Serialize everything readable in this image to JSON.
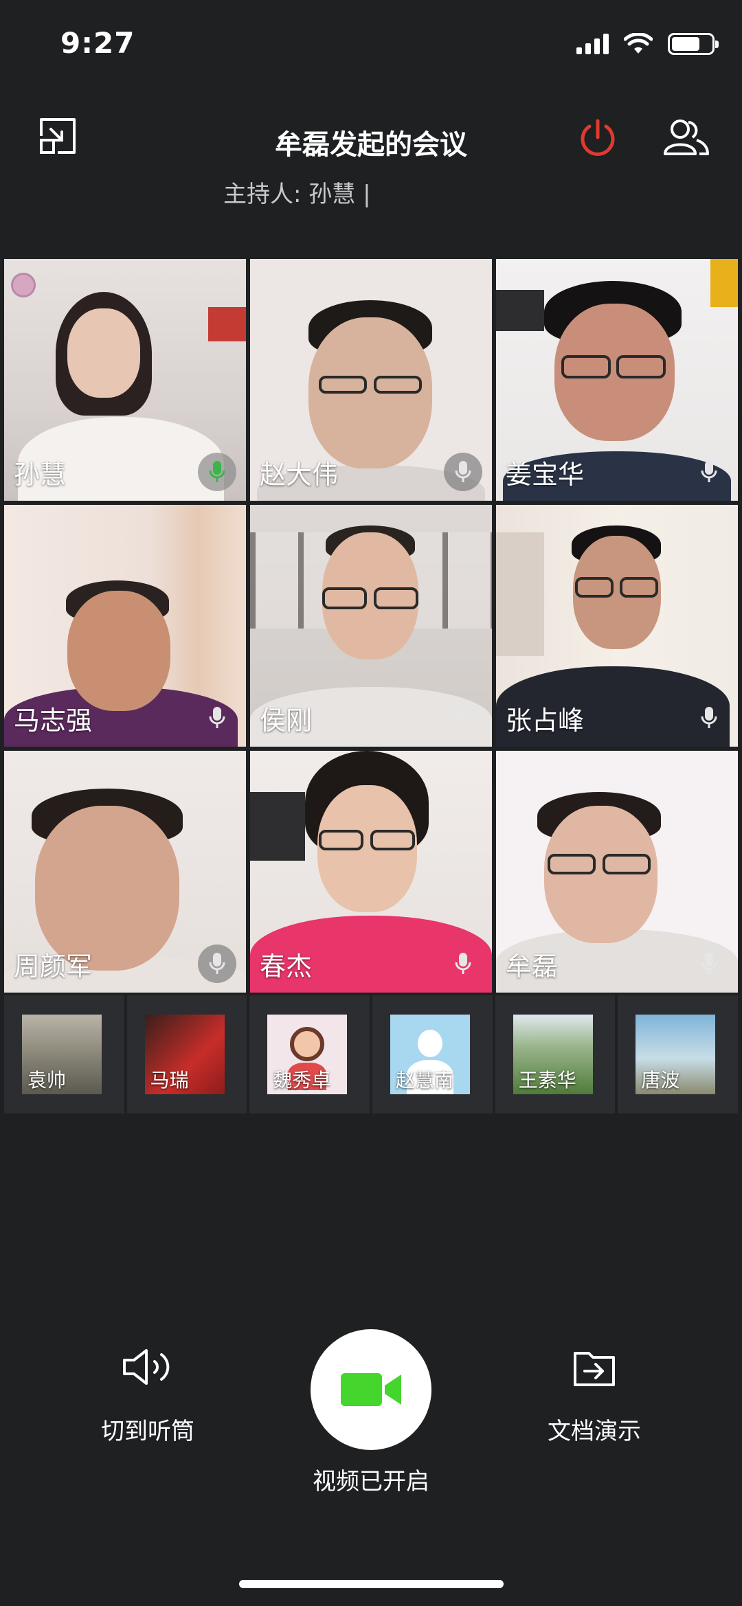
{
  "status_bar": {
    "time": "9:27"
  },
  "header": {
    "title": "牟磊发起的会议",
    "host_label": "主持人: 孙慧 |"
  },
  "grid": [
    {
      "name": "孙慧",
      "mic": "active"
    },
    {
      "name": "赵大伟",
      "mic": "idle"
    },
    {
      "name": "姜宝华",
      "mic": "idle"
    },
    {
      "name": "马志强",
      "mic": "idle"
    },
    {
      "name": "侯刚",
      "mic": "idle"
    },
    {
      "name": "张占峰",
      "mic": "idle"
    },
    {
      "name": "周颜军",
      "mic": "idle"
    },
    {
      "name": "春杰",
      "mic": "idle"
    },
    {
      "name": "牟磊",
      "mic": "idle"
    }
  ],
  "thumbnails": [
    {
      "name": "袁帅"
    },
    {
      "name": "马瑞"
    },
    {
      "name": "魏秀卓"
    },
    {
      "name": "赵慧南"
    },
    {
      "name": "王素华"
    },
    {
      "name": "唐波"
    }
  ],
  "controls": {
    "speaker_label": "切到听筒",
    "video_label": "视频已开启",
    "docs_label": "文档演示"
  },
  "colors": {
    "background": "#1f2022",
    "power_red": "#e03a2f",
    "video_green": "#44d62c",
    "mic_active_green": "#3ab54a"
  },
  "icons": {
    "exit_fullscreen": "exit-fullscreen-icon",
    "power": "power-icon",
    "participants": "participants-icon",
    "mic": "microphone-icon",
    "speaker": "speaker-icon",
    "video": "video-camera-icon",
    "docs": "share-document-icon"
  }
}
